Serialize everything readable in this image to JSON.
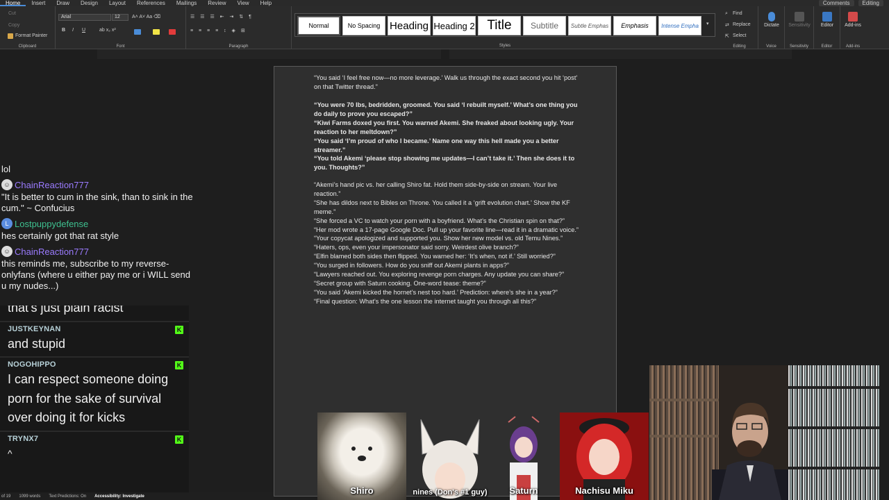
{
  "menu": {
    "tabs": [
      "Home",
      "Insert",
      "Draw",
      "Design",
      "Layout",
      "References",
      "Mailings",
      "Review",
      "View",
      "Help"
    ],
    "comments_label": "Comments",
    "editing_label": "Editing"
  },
  "ribbon": {
    "clipboard": {
      "cut": "Cut",
      "copy": "Copy",
      "format_painter": "Format Painter",
      "label": "Clipboard"
    },
    "font": {
      "name": "Arial",
      "size": "12",
      "label": "Font"
    },
    "paragraph": {
      "label": "Paragraph"
    },
    "styles": {
      "label": "Styles",
      "items": [
        "Normal",
        "No Spacing",
        "Heading",
        "Heading 2",
        "Title",
        "Subtitle",
        "Subtle Emphas",
        "Emphasis",
        "Intense Empha"
      ]
    },
    "editing": {
      "find": "Find",
      "replace": "Replace",
      "select": "Select",
      "label": "Editing"
    },
    "voice": {
      "dictate": "Dictate",
      "label": "Voice"
    },
    "sensitivity": {
      "button": "Sensitivity",
      "label": "Sensitivity"
    },
    "editor": {
      "button": "Editor",
      "label": "Editor"
    },
    "addins": {
      "button": "Add-ins",
      "label": "Add-ins"
    }
  },
  "document": {
    "block1": [
      "“You said ‘I feel free now—no more leverage.’ Walk us through the exact second you hit ‘post’ on that Twitter thread.”"
    ],
    "block2": [
      "“You were 70 lbs, bedridden, groomed. You said ‘I rebuilt myself.’ What’s one thing you do daily to prove you escaped?”",
      "“Kiwi Farms doxed you first. You warned Akemi. She freaked about looking ugly. Your reaction to her meltdown?”",
      "“You said ‘I’m proud of who I became.’ Name one way this hell made you a better streamer.”",
      "“You told Akemi ‘please stop showing me updates—I can’t take it.’ Then she does it to you. Thoughts?”"
    ],
    "block3": [
      "“Akemi’s hand pic vs. her calling Shiro fat. Hold them side-by-side on stream. Your live reaction.”",
      "“She has dildos next to Bibles on Throne. You called it a ‘grift evolution chart.’ Show the KF meme.”",
      "“She forced a VC to watch your porn with a boyfriend. What’s the Christian spin on that?”",
      "“Her mod wrote a 17-page Google Doc. Pull up your favorite line—read it in a dramatic voice.”",
      "“Your copycat apologized and supported you. Show her new model vs. old Temu Nines.”",
      "“Haters, ops, even your impersonator said sorry. Weirdest olive branch?”",
      "“Elfin blamed both sides then flipped. You warned her: ‘It’s when, not if.’ Still worried?”",
      "“You surged in followers. How do you sniff out Akemi plants in apps?”",
      "“Lawyers reached out. You exploring revenge porn charges. Any update you can share?”",
      "“Secret group with Saturn cooking. One-word tease: theme?”",
      "“You said ‘Akemi kicked the hornet’s nest too hard.’ Prediction: where’s she in a year?”",
      "“Final question: What’s the one lesson the internet taught you through all this?”"
    ]
  },
  "chat_overlay_1": {
    "top_msg": "lol",
    "messages": [
      {
        "user": "ChainReaction777",
        "text": "\"It is better to cum in the sink, than to sink in the cum.\" ~ Confucius",
        "color": "#9b7bff",
        "avatar": "icon"
      },
      {
        "user": "Lostpuppydefense",
        "text": "hes certainly got that rat style",
        "color": "#3ec08f",
        "avatar": "L"
      },
      {
        "user": "ChainReaction777",
        "text": "this reminds me, subscribe to my reverse-onlyfans (where u either pay me or i WILL send u my nudes...)",
        "color": "#9b7bff",
        "avatar": "icon"
      }
    ]
  },
  "chat_overlay_2": {
    "partial": "that's just plain racist",
    "messages": [
      {
        "user": "JUSTKEYNAN",
        "text": "and stupid"
      },
      {
        "user": "NOGOHIPPO",
        "text": "I can respect someone doing porn for the sake of survival over doing it for kicks"
      },
      {
        "user": "TRYNX7",
        "text": "^"
      }
    ],
    "badge": "K"
  },
  "statusbar": {
    "page": "of 19",
    "words": "1099 words",
    "predictions": "Text Predictions: On",
    "accessibility": "Accessibility: Investigate"
  },
  "avatars": [
    "Shiro",
    "nines (Don's #1 guy)",
    "Saturn",
    "Nachisu Miku"
  ]
}
